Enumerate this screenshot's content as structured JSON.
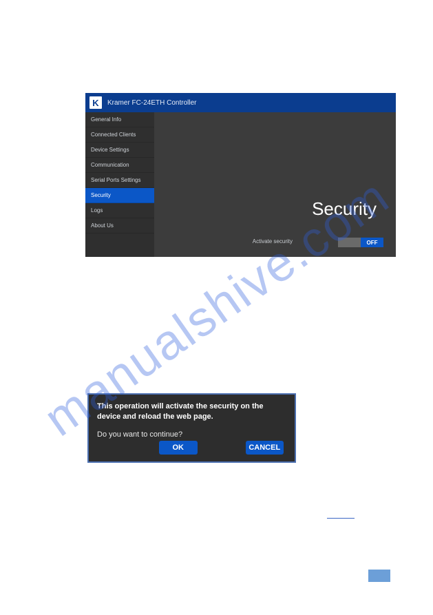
{
  "watermark": "manualshive.com",
  "controller": {
    "logo_letter": "K",
    "title": "Kramer FC-24ETH Controller",
    "sidebar": {
      "items": [
        {
          "label": "General Info"
        },
        {
          "label": "Connected Clients"
        },
        {
          "label": "Device Settings"
        },
        {
          "label": "Communication"
        },
        {
          "label": "Serial Ports Settings"
        },
        {
          "label": "Security"
        },
        {
          "label": "Logs"
        },
        {
          "label": "About Us"
        }
      ],
      "active_index": 5
    },
    "main": {
      "heading": "Security",
      "activate_label": "Activate security",
      "toggle_state": "OFF"
    }
  },
  "dialog": {
    "message": "This operation will activate the security on the device and reload the web page.",
    "question": "Do you want to continue?",
    "ok_label": "OK",
    "cancel_label": "CANCEL"
  }
}
